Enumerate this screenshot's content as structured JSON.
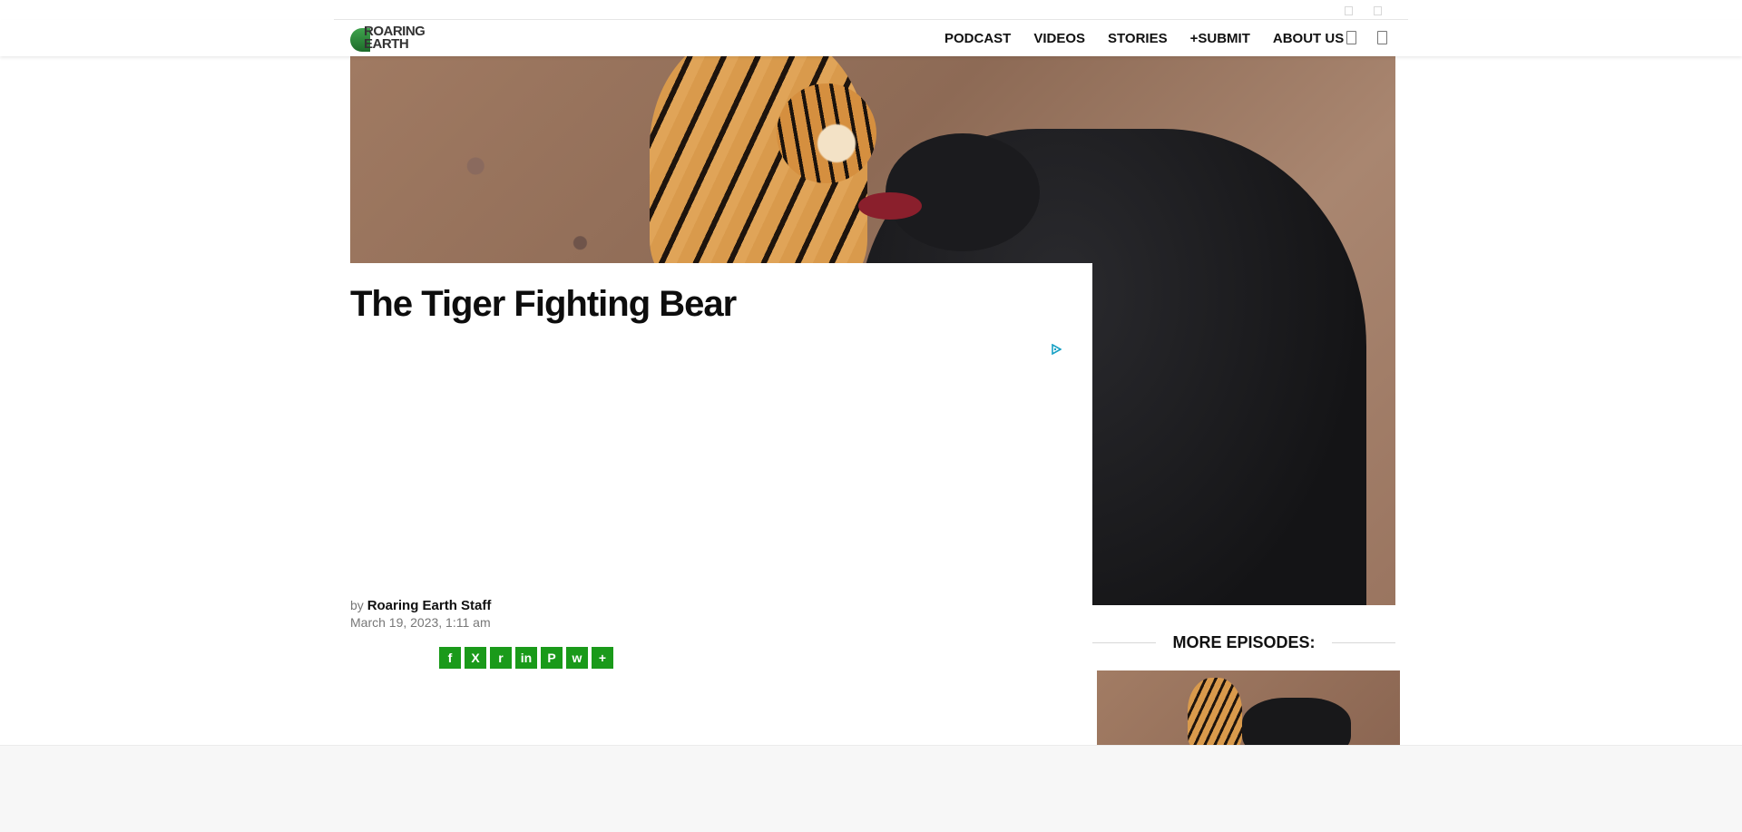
{
  "brand": {
    "logo_line1": "ROARING",
    "logo_line2": "EARTH"
  },
  "nav": {
    "items": [
      {
        "label": "PODCAST"
      },
      {
        "label": "VIDEOS"
      },
      {
        "label": "STORIES"
      },
      {
        "label": "+SUBMIT"
      },
      {
        "label": "ABOUT US"
      }
    ]
  },
  "icons": [
    "search-icon",
    "menu-icon",
    "ad-choices-icon",
    "facebook-icon",
    "x-icon",
    "reddit-icon",
    "linkedin-icon",
    "pinterest-icon",
    "whatsapp-icon",
    "share-more-icon"
  ],
  "article": {
    "title": "The Tiger Fighting Bear",
    "byline_prefix": "by",
    "author": "Roaring Earth Staff",
    "date": "March 19, 2023, 1:11 am"
  },
  "share": [
    {
      "name": "Facebook",
      "glyph": "f"
    },
    {
      "name": "X",
      "glyph": "X"
    },
    {
      "name": "Reddit",
      "glyph": "r"
    },
    {
      "name": "LinkedIn",
      "glyph": "in"
    },
    {
      "name": "Pinterest",
      "glyph": "P"
    },
    {
      "name": "WhatsApp",
      "glyph": "w"
    },
    {
      "name": "More",
      "glyph": "+"
    }
  ],
  "sidebar": {
    "heading": "MORE EPISODES:"
  },
  "colors": {
    "share_green": "#1a9a1a",
    "logo_green": "#2e8b3a"
  }
}
